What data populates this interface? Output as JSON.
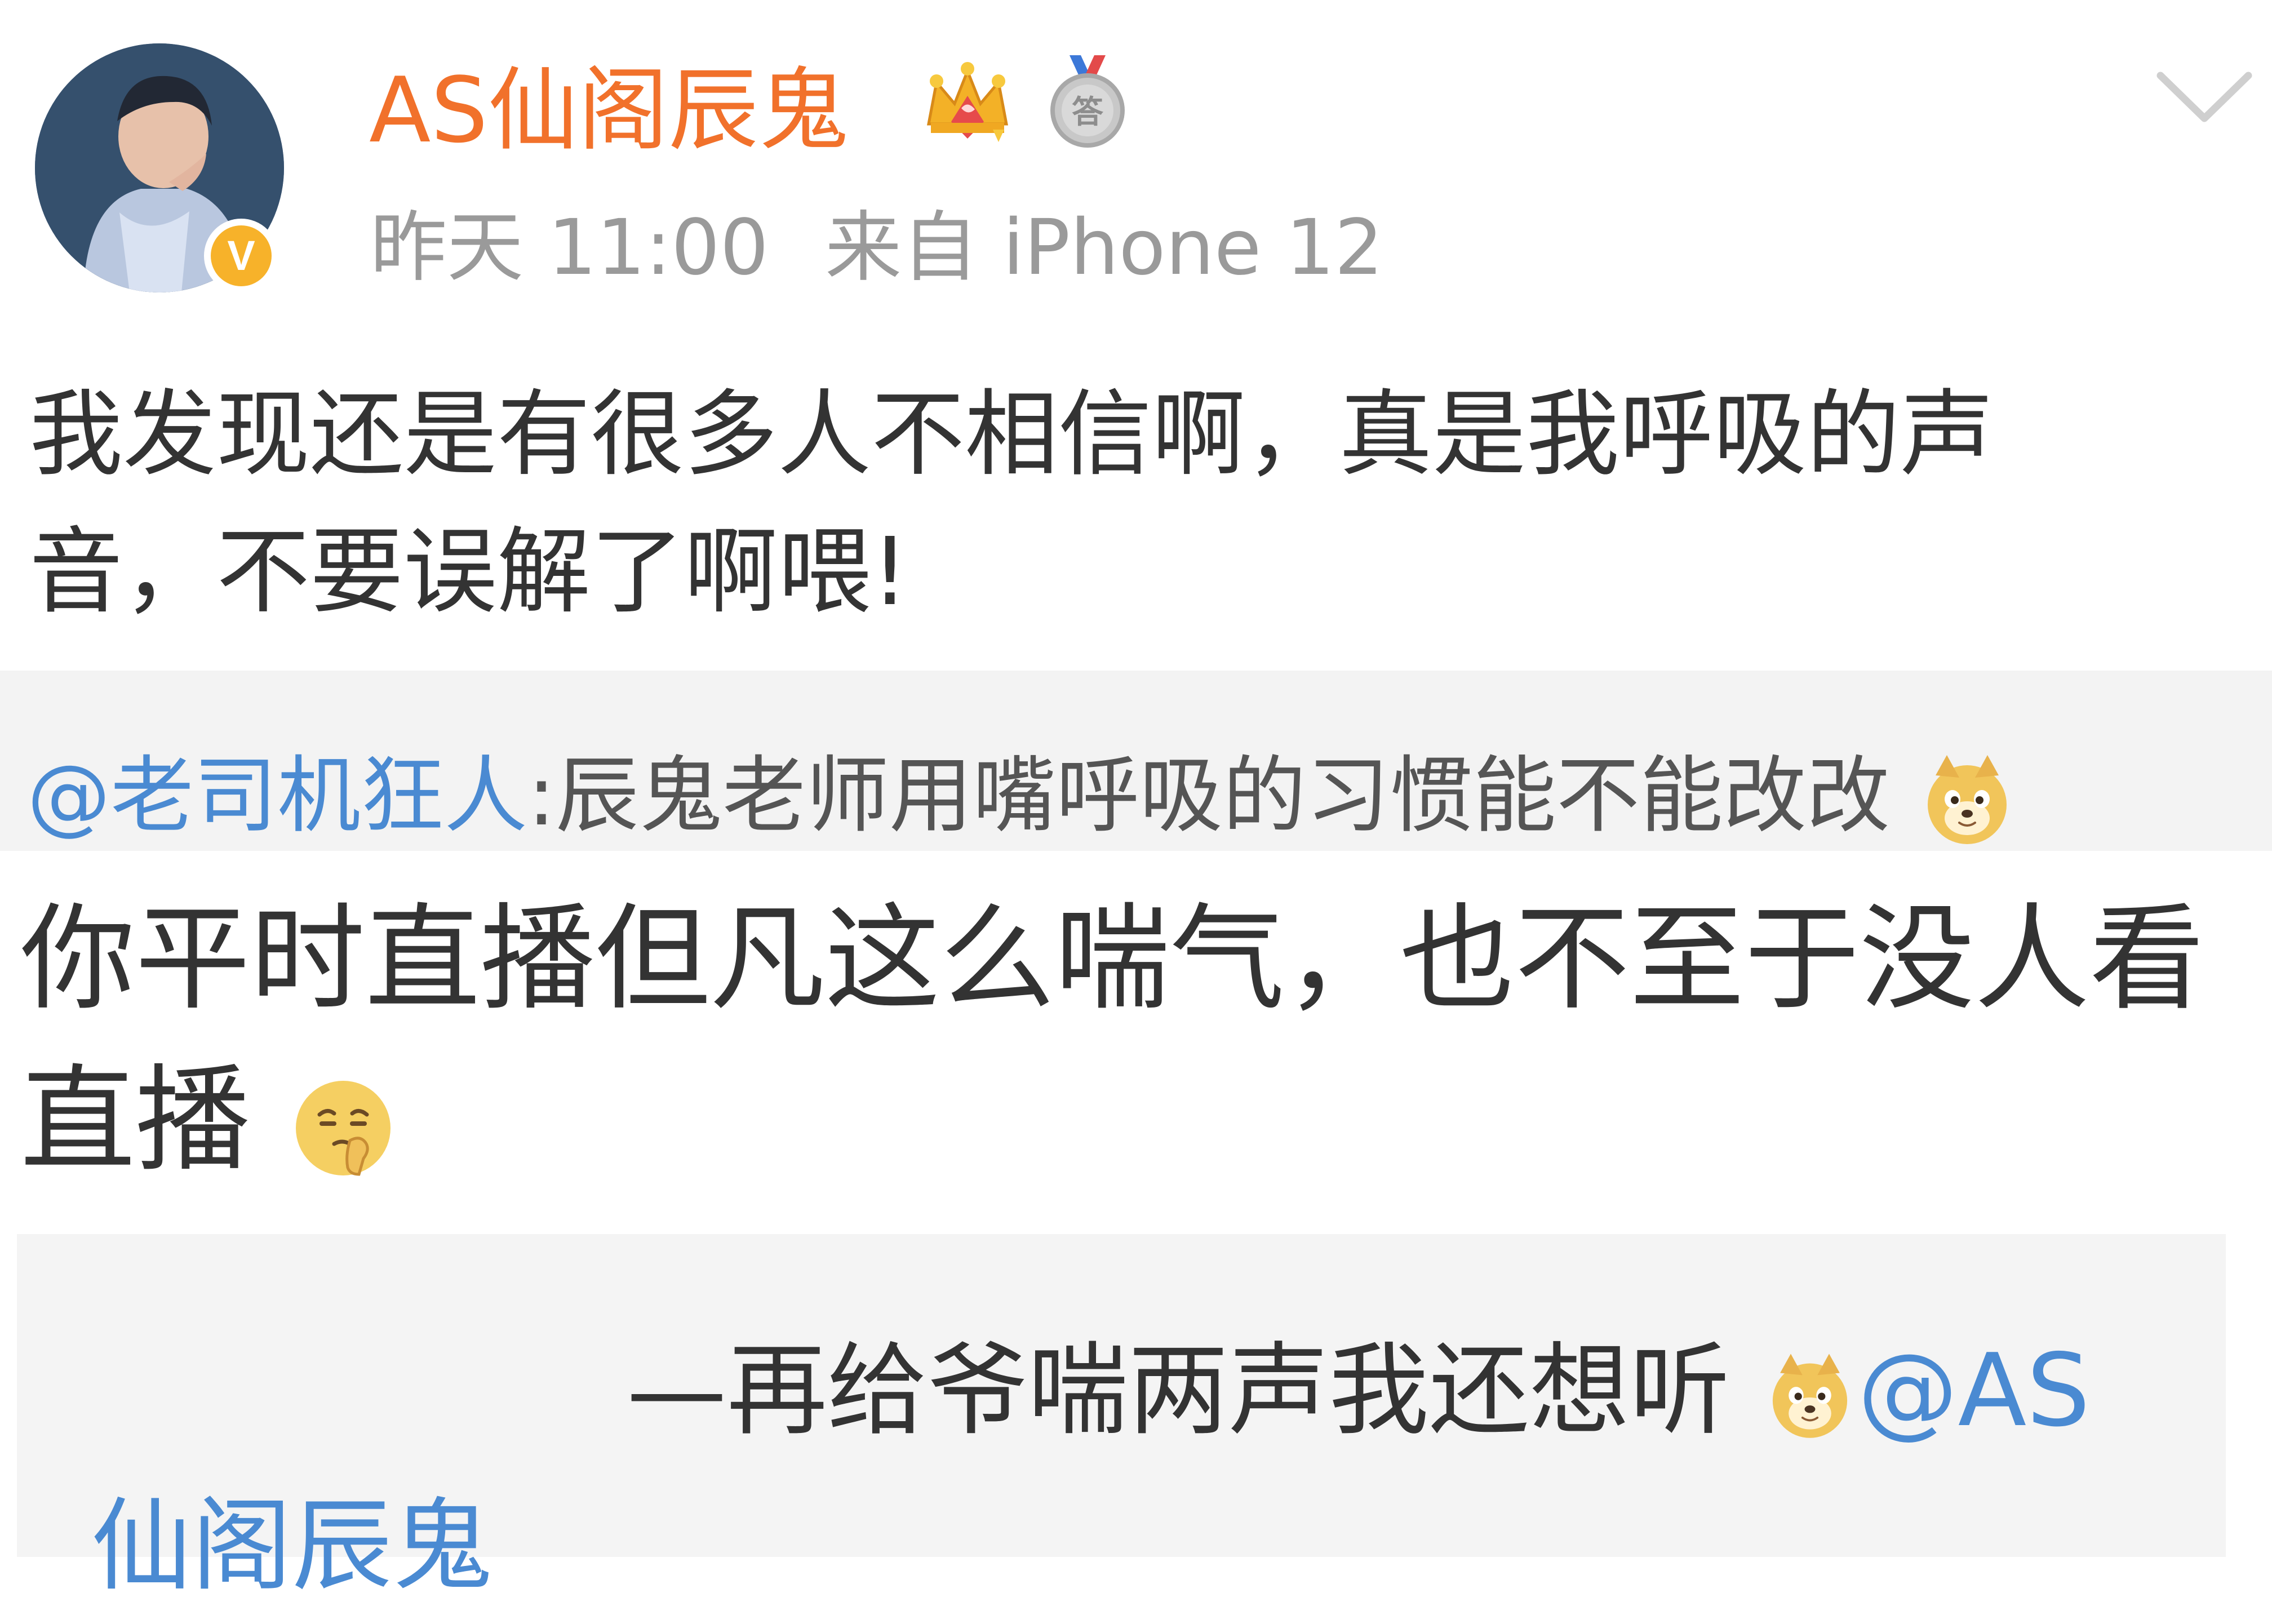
{
  "post": {
    "author": "AS仙阁辰鬼",
    "time": "昨天 11:00",
    "source": "来自 iPhone 12",
    "body": "我发现还是有很多人不相信啊，真是我呼吸的声音，不要误解了啊喂!",
    "icons": {
      "avatar": "avatar-photo",
      "verified": "verified-v-badge",
      "crown": "crown-icon",
      "medal": "answer-medal-icon",
      "menu": "chevron-down-icon"
    },
    "verified_label": "V",
    "medal_label": "答",
    "colors": {
      "username": "#f1712b",
      "mention": "#4a8ad2",
      "verified": "#f7b22a",
      "meta": "#9a9a9a"
    }
  },
  "repost": {
    "mention": "@老司机狂人",
    "separator": ":",
    "text": "辰鬼老师用嘴呼吸的习惯能不能改改",
    "emoji": "doge-emoji"
  },
  "reply": {
    "text": "你平时直播但凡这么喘气，也不至于没人看直播",
    "emoji": "shush-emoji"
  },
  "quote": {
    "prefix": "—",
    "text": "再给爷喘两声我还想听",
    "emoji": "doge-emoji",
    "mention": "@AS仙阁辰鬼"
  }
}
